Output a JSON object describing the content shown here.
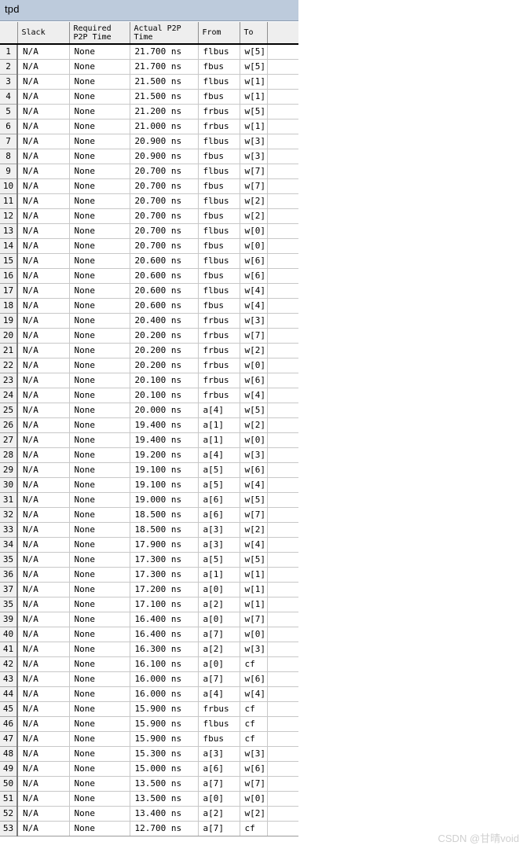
{
  "window": {
    "title": "tpd",
    "titlebar_color": "#bdcbdc"
  },
  "table": {
    "columns": [
      {
        "key": "num",
        "label": ""
      },
      {
        "key": "slack",
        "label": "Slack"
      },
      {
        "key": "req",
        "label": "Required\nP2P Time"
      },
      {
        "key": "act",
        "label": "Actual P2P\nTime"
      },
      {
        "key": "from",
        "label": "From"
      },
      {
        "key": "to",
        "label": "To"
      },
      {
        "key": "pad",
        "label": ""
      }
    ],
    "rows": [
      {
        "num": "1",
        "slack": "N/A",
        "req": "None",
        "act": "21.700 ns",
        "from": "flbus",
        "to": "w[5]"
      },
      {
        "num": "2",
        "slack": "N/A",
        "req": "None",
        "act": "21.700 ns",
        "from": "fbus",
        "to": "w[5]"
      },
      {
        "num": "3",
        "slack": "N/A",
        "req": "None",
        "act": "21.500 ns",
        "from": "flbus",
        "to": "w[1]"
      },
      {
        "num": "4",
        "slack": "N/A",
        "req": "None",
        "act": "21.500 ns",
        "from": "fbus",
        "to": "w[1]"
      },
      {
        "num": "5",
        "slack": "N/A",
        "req": "None",
        "act": "21.200 ns",
        "from": "frbus",
        "to": "w[5]"
      },
      {
        "num": "6",
        "slack": "N/A",
        "req": "None",
        "act": "21.000 ns",
        "from": "frbus",
        "to": "w[1]"
      },
      {
        "num": "7",
        "slack": "N/A",
        "req": "None",
        "act": "20.900 ns",
        "from": "flbus",
        "to": "w[3]"
      },
      {
        "num": "8",
        "slack": "N/A",
        "req": "None",
        "act": "20.900 ns",
        "from": "fbus",
        "to": "w[3]"
      },
      {
        "num": "9",
        "slack": "N/A",
        "req": "None",
        "act": "20.700 ns",
        "from": "flbus",
        "to": "w[7]"
      },
      {
        "num": "10",
        "slack": "N/A",
        "req": "None",
        "act": "20.700 ns",
        "from": "fbus",
        "to": "w[7]"
      },
      {
        "num": "11",
        "slack": "N/A",
        "req": "None",
        "act": "20.700 ns",
        "from": "flbus",
        "to": "w[2]"
      },
      {
        "num": "12",
        "slack": "N/A",
        "req": "None",
        "act": "20.700 ns",
        "from": "fbus",
        "to": "w[2]"
      },
      {
        "num": "13",
        "slack": "N/A",
        "req": "None",
        "act": "20.700 ns",
        "from": "flbus",
        "to": "w[0]"
      },
      {
        "num": "14",
        "slack": "N/A",
        "req": "None",
        "act": "20.700 ns",
        "from": "fbus",
        "to": "w[0]"
      },
      {
        "num": "15",
        "slack": "N/A",
        "req": "None",
        "act": "20.600 ns",
        "from": "flbus",
        "to": "w[6]"
      },
      {
        "num": "16",
        "slack": "N/A",
        "req": "None",
        "act": "20.600 ns",
        "from": "fbus",
        "to": "w[6]"
      },
      {
        "num": "17",
        "slack": "N/A",
        "req": "None",
        "act": "20.600 ns",
        "from": "flbus",
        "to": "w[4]"
      },
      {
        "num": "18",
        "slack": "N/A",
        "req": "None",
        "act": "20.600 ns",
        "from": "fbus",
        "to": "w[4]"
      },
      {
        "num": "19",
        "slack": "N/A",
        "req": "None",
        "act": "20.400 ns",
        "from": "frbus",
        "to": "w[3]"
      },
      {
        "num": "20",
        "slack": "N/A",
        "req": "None",
        "act": "20.200 ns",
        "from": "frbus",
        "to": "w[7]"
      },
      {
        "num": "21",
        "slack": "N/A",
        "req": "None",
        "act": "20.200 ns",
        "from": "frbus",
        "to": "w[2]"
      },
      {
        "num": "22",
        "slack": "N/A",
        "req": "None",
        "act": "20.200 ns",
        "from": "frbus",
        "to": "w[0]"
      },
      {
        "num": "23",
        "slack": "N/A",
        "req": "None",
        "act": "20.100 ns",
        "from": "frbus",
        "to": "w[6]"
      },
      {
        "num": "24",
        "slack": "N/A",
        "req": "None",
        "act": "20.100 ns",
        "from": "frbus",
        "to": "w[4]"
      },
      {
        "num": "25",
        "slack": "N/A",
        "req": "None",
        "act": "20.000 ns",
        "from": "a[4]",
        "to": "w[5]"
      },
      {
        "num": "26",
        "slack": "N/A",
        "req": "None",
        "act": "19.400 ns",
        "from": "a[1]",
        "to": "w[2]"
      },
      {
        "num": "27",
        "slack": "N/A",
        "req": "None",
        "act": "19.400 ns",
        "from": "a[1]",
        "to": "w[0]"
      },
      {
        "num": "28",
        "slack": "N/A",
        "req": "None",
        "act": "19.200 ns",
        "from": "a[4]",
        "to": "w[3]"
      },
      {
        "num": "29",
        "slack": "N/A",
        "req": "None",
        "act": "19.100 ns",
        "from": "a[5]",
        "to": "w[6]"
      },
      {
        "num": "30",
        "slack": "N/A",
        "req": "None",
        "act": "19.100 ns",
        "from": "a[5]",
        "to": "w[4]"
      },
      {
        "num": "31",
        "slack": "N/A",
        "req": "None",
        "act": "19.000 ns",
        "from": "a[6]",
        "to": "w[5]"
      },
      {
        "num": "32",
        "slack": "N/A",
        "req": "None",
        "act": "18.500 ns",
        "from": "a[6]",
        "to": "w[7]"
      },
      {
        "num": "33",
        "slack": "N/A",
        "req": "None",
        "act": "18.500 ns",
        "from": "a[3]",
        "to": "w[2]"
      },
      {
        "num": "34",
        "slack": "N/A",
        "req": "None",
        "act": "17.900 ns",
        "from": "a[3]",
        "to": "w[4]"
      },
      {
        "num": "35",
        "slack": "N/A",
        "req": "None",
        "act": "17.300 ns",
        "from": "a[5]",
        "to": "w[5]"
      },
      {
        "num": "36",
        "slack": "N/A",
        "req": "None",
        "act": "17.300 ns",
        "from": "a[1]",
        "to": "w[1]"
      },
      {
        "num": "37",
        "slack": "N/A",
        "req": "None",
        "act": "17.200 ns",
        "from": "a[0]",
        "to": "w[1]"
      },
      {
        "num": "35",
        "slack": "N/A",
        "req": "None",
        "act": "17.100 ns",
        "from": "a[2]",
        "to": "w[1]"
      },
      {
        "num": "39",
        "slack": "N/A",
        "req": "None",
        "act": "16.400 ns",
        "from": "a[0]",
        "to": "w[7]"
      },
      {
        "num": "40",
        "slack": "N/A",
        "req": "None",
        "act": "16.400 ns",
        "from": "a[7]",
        "to": "w[0]"
      },
      {
        "num": "41",
        "slack": "N/A",
        "req": "None",
        "act": "16.300 ns",
        "from": "a[2]",
        "to": "w[3]"
      },
      {
        "num": "42",
        "slack": "N/A",
        "req": "None",
        "act": "16.100 ns",
        "from": "a[0]",
        "to": "cf"
      },
      {
        "num": "43",
        "slack": "N/A",
        "req": "None",
        "act": "16.000 ns",
        "from": "a[7]",
        "to": "w[6]"
      },
      {
        "num": "44",
        "slack": "N/A",
        "req": "None",
        "act": "16.000 ns",
        "from": "a[4]",
        "to": "w[4]"
      },
      {
        "num": "45",
        "slack": "N/A",
        "req": "None",
        "act": "15.900 ns",
        "from": "frbus",
        "to": "cf"
      },
      {
        "num": "46",
        "slack": "N/A",
        "req": "None",
        "act": "15.900 ns",
        "from": "flbus",
        "to": "cf"
      },
      {
        "num": "47",
        "slack": "N/A",
        "req": "None",
        "act": "15.900 ns",
        "from": "fbus",
        "to": "cf"
      },
      {
        "num": "48",
        "slack": "N/A",
        "req": "None",
        "act": "15.300 ns",
        "from": "a[3]",
        "to": "w[3]"
      },
      {
        "num": "49",
        "slack": "N/A",
        "req": "None",
        "act": "15.000 ns",
        "from": "a[6]",
        "to": "w[6]"
      },
      {
        "num": "50",
        "slack": "N/A",
        "req": "None",
        "act": "13.500 ns",
        "from": "a[7]",
        "to": "w[7]"
      },
      {
        "num": "51",
        "slack": "N/A",
        "req": "None",
        "act": "13.500 ns",
        "from": "a[0]",
        "to": "w[0]"
      },
      {
        "num": "52",
        "slack": "N/A",
        "req": "None",
        "act": "13.400 ns",
        "from": "a[2]",
        "to": "w[2]"
      },
      {
        "num": "53",
        "slack": "N/A",
        "req": "None",
        "act": "12.700 ns",
        "from": "a[7]",
        "to": "cf"
      }
    ]
  },
  "watermark": {
    "text": "CSDN @甘晴void"
  }
}
